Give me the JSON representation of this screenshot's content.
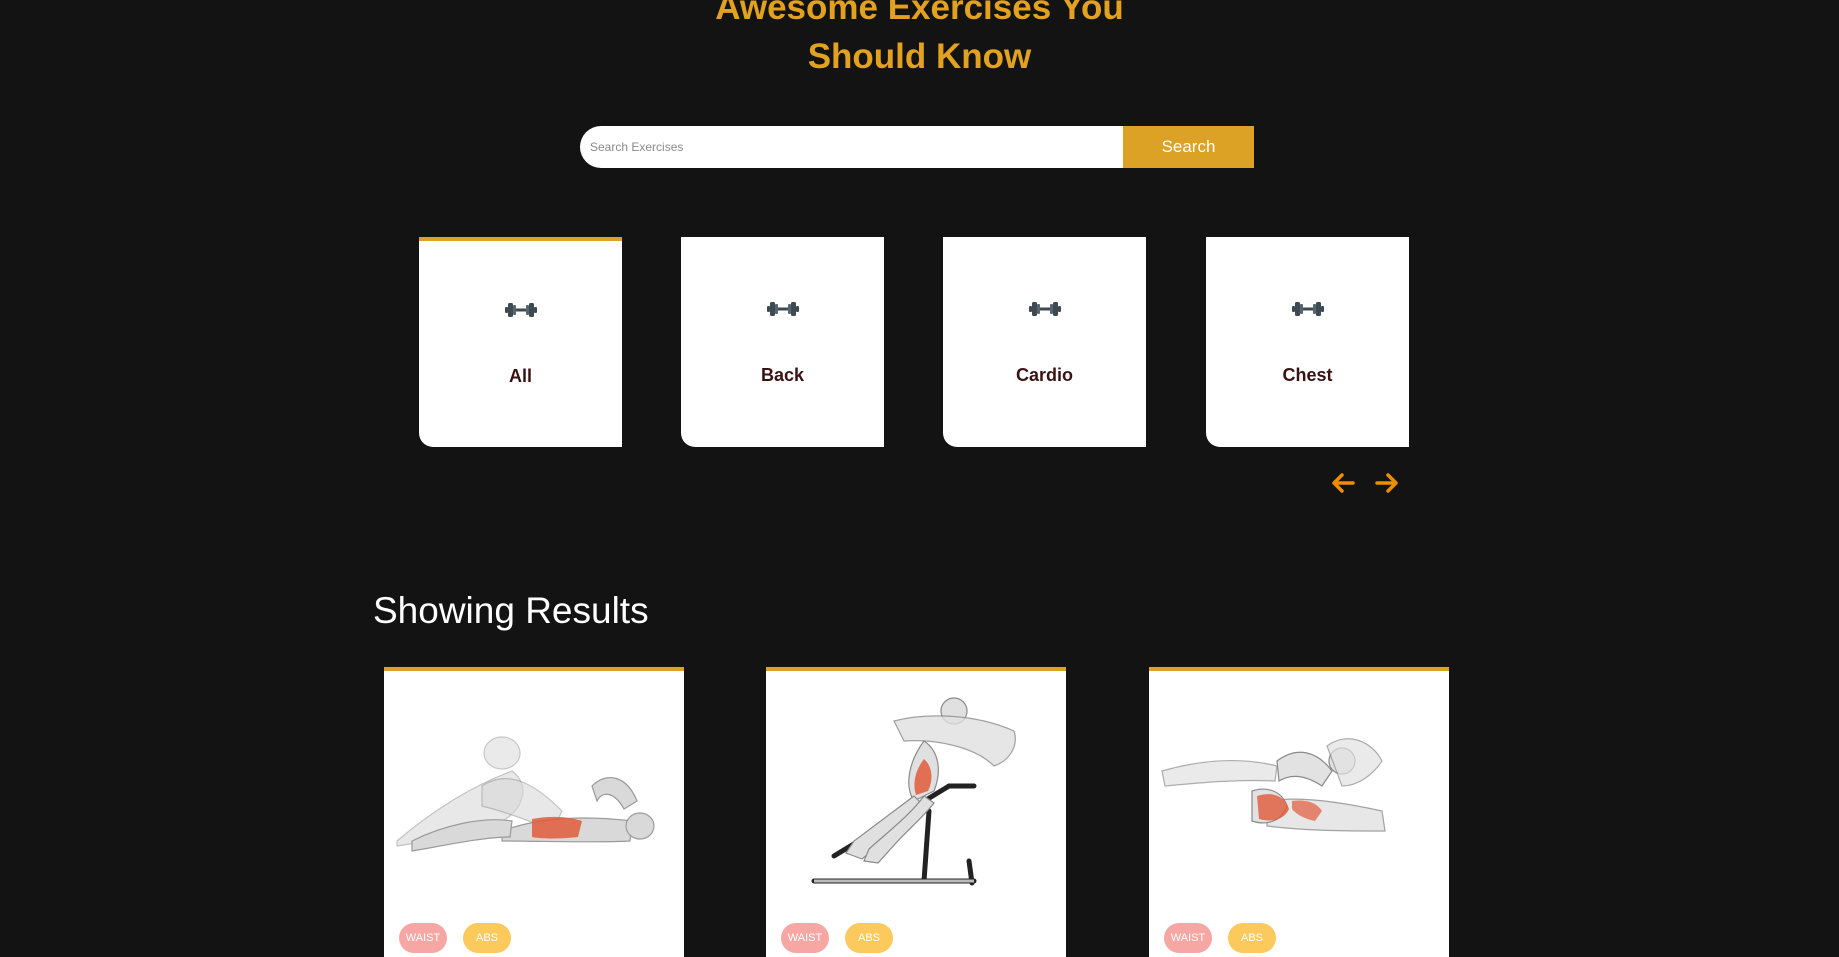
{
  "hero": {
    "title_line1": "Awesome Exercises You",
    "title_line2": "Should Know"
  },
  "search": {
    "placeholder": "Search Exercises",
    "value": "",
    "button_label": "Search"
  },
  "categories": {
    "items": [
      {
        "label": "All",
        "icon": "dumbbell-icon",
        "active": true
      },
      {
        "label": "Back",
        "icon": "dumbbell-icon",
        "active": false
      },
      {
        "label": "Cardio",
        "icon": "dumbbell-icon",
        "active": false
      },
      {
        "label": "Chest",
        "icon": "dumbbell-icon",
        "active": false
      }
    ],
    "prev_icon": "arrow-left-icon",
    "next_icon": "arrow-right-icon"
  },
  "results": {
    "heading": "Showing Results",
    "cards": [
      {
        "illustration": "crunch-exercise-illustration",
        "body_part": "WAIST",
        "target": "ABS"
      },
      {
        "illustration": "decline-crunch-exercise-illustration",
        "body_part": "WAIST",
        "target": "ABS"
      },
      {
        "illustration": "bicycle-crunch-exercise-illustration",
        "body_part": "WAIST",
        "target": "ABS"
      }
    ]
  },
  "colors": {
    "background": "#131313",
    "accent": "#dca225",
    "title": "#e2a21f",
    "arrow": "#f08c00",
    "tag_body_part": "#f7a7a3",
    "tag_target": "#fbc95c",
    "muscle_highlight": "#e05a3a"
  }
}
